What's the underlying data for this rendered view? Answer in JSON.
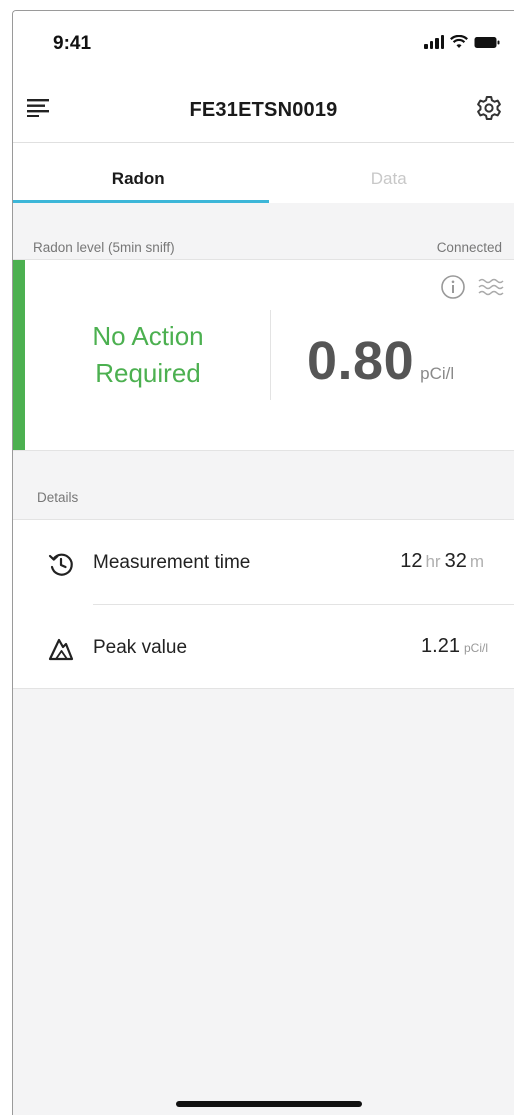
{
  "status_bar": {
    "time": "9:41"
  },
  "header": {
    "device_name": "FE31ETSN0019"
  },
  "tabs": [
    {
      "label": "Radon",
      "active": true
    },
    {
      "label": "Data",
      "active": false
    }
  ],
  "radon": {
    "section_label": "Radon level (5min sniff)",
    "connection_status": "Connected",
    "status_line1": "No Action",
    "status_line2": "Required",
    "value": "0.80",
    "unit": "pCi/l",
    "status_color": "#4cb050"
  },
  "details": {
    "section_label": "Details",
    "measurement": {
      "label": "Measurement time",
      "hours": "12",
      "hours_unit": "hr",
      "minutes": "32",
      "minutes_unit": "m"
    },
    "peak": {
      "label": "Peak value",
      "value": "1.21",
      "unit": "pCi/l"
    }
  },
  "colors": {
    "accent": "#3cb6d8",
    "ok": "#4cb050"
  }
}
